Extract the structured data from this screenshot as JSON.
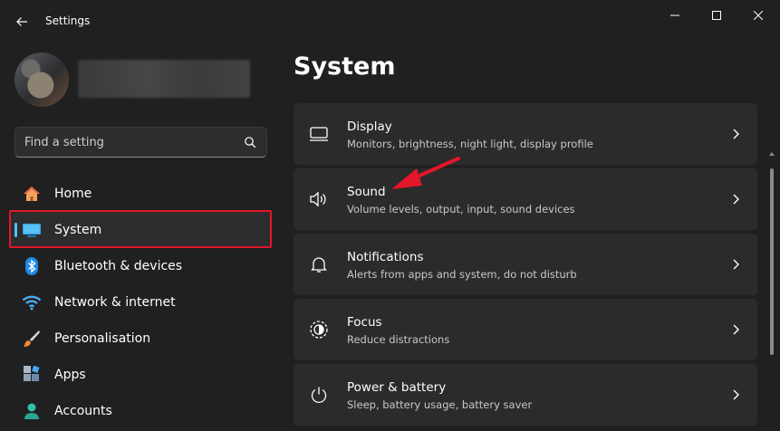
{
  "window": {
    "title": "Settings",
    "controls": [
      "minimize",
      "maximize",
      "close"
    ]
  },
  "search": {
    "placeholder": "Find a setting",
    "value": ""
  },
  "nav": {
    "items": [
      {
        "label": "Home",
        "icon": "home-icon",
        "active": false
      },
      {
        "label": "System",
        "icon": "system-display-icon",
        "active": true
      },
      {
        "label": "Bluetooth & devices",
        "icon": "bluetooth-icon",
        "active": false
      },
      {
        "label": "Network & internet",
        "icon": "wifi-icon",
        "active": false
      },
      {
        "label": "Personalisation",
        "icon": "brush-icon",
        "active": false
      },
      {
        "label": "Apps",
        "icon": "apps-icon",
        "active": false
      },
      {
        "label": "Accounts",
        "icon": "person-icon",
        "active": false
      }
    ]
  },
  "main": {
    "title": "System",
    "cards": [
      {
        "title": "Display",
        "subtitle": "Monitors, brightness, night light, display profile",
        "icon": "monitor-icon"
      },
      {
        "title": "Sound",
        "subtitle": "Volume levels, output, input, sound devices",
        "icon": "speaker-icon"
      },
      {
        "title": "Notifications",
        "subtitle": "Alerts from apps and system, do not disturb",
        "icon": "bell-icon"
      },
      {
        "title": "Focus",
        "subtitle": "Reduce distractions",
        "icon": "focus-icon"
      },
      {
        "title": "Power & battery",
        "subtitle": "Sleep, battery usage, battery saver",
        "icon": "power-icon"
      }
    ]
  },
  "colors": {
    "accent": "#4cc2ff",
    "annotation_red": "#e3162a",
    "background": "#202020",
    "card": "#2b2b2b"
  }
}
